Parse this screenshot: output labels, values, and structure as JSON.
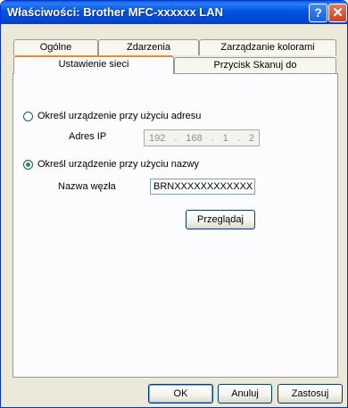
{
  "window": {
    "title": "Właściwości: Brother MFC-xxxxxx LAN"
  },
  "titlebar": {
    "help_symbol": "?",
    "close_symbol": "✕"
  },
  "tabs": {
    "row1": [
      "Ogólne",
      "Zdarzenia",
      "Zarządzanie kolorami"
    ],
    "row2": [
      "Ustawienie sieci",
      "Przycisk Skanuj do"
    ],
    "active": "Ustawienie sieci"
  },
  "network": {
    "radio_address_label": "Określ urządzenie przy użyciu adresu",
    "ip_label": "Adres IP",
    "ip_octets": [
      "192",
      "168",
      "1",
      "2"
    ],
    "radio_name_label": "Określ urządzenie przy użyciu nazwy",
    "node_name_label": "Nazwa węzła",
    "node_name_value": "BRNXXXXXXXXXXXX",
    "browse_button": "Przeglądaj",
    "selected_option": "name"
  },
  "footer": {
    "ok": "OK",
    "cancel": "Anuluj",
    "apply": "Zastosuj"
  }
}
